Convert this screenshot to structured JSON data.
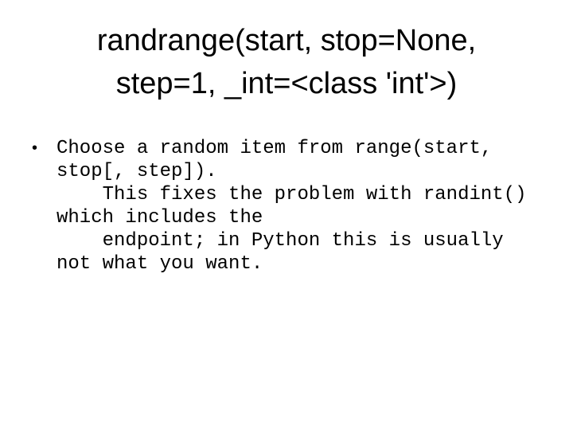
{
  "slide": {
    "title_lines": [
      "randrange(start, stop=None,",
      "step=1, _int=<class 'int'>)"
    ],
    "bullets": [
      {
        "symbol": "•",
        "lines": [
          "Choose a random item from range(start,",
          "stop[, step]).",
          "    This fixes the problem with randint()",
          "which includes the",
          "    endpoint; in Python this is usually",
          "not what you want."
        ]
      }
    ]
  }
}
